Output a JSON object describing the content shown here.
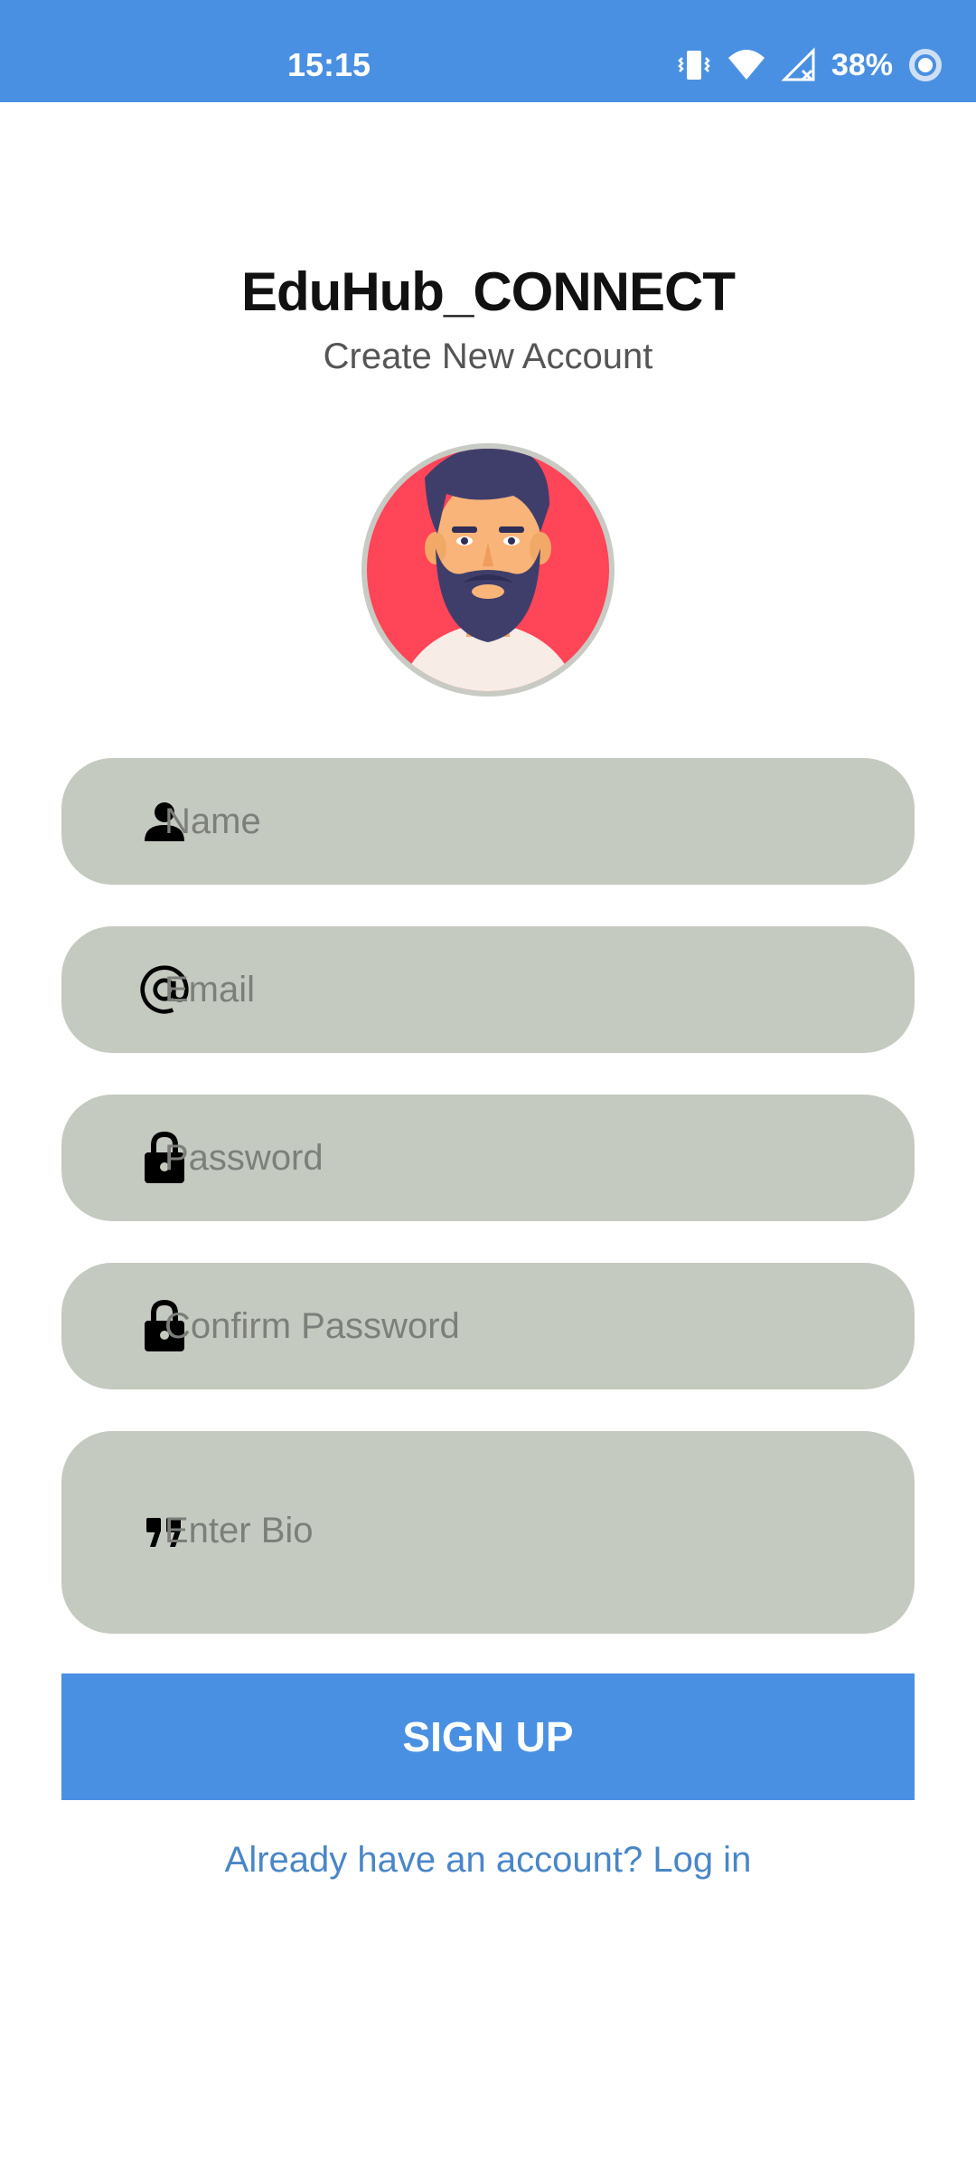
{
  "status_bar": {
    "time": "15:15",
    "battery_percent": "38%",
    "icons": [
      "vibrate-icon",
      "wifi-icon",
      "cell-signal-off-icon",
      "battery-ring-icon"
    ]
  },
  "app": {
    "title": "EduHub_CONNECT",
    "subtitle": "Create New Account"
  },
  "avatar": {
    "icon": "bearded-man-avatar"
  },
  "form": {
    "name": {
      "placeholder": "Name",
      "value": "",
      "icon": "person-icon"
    },
    "email": {
      "placeholder": "Email",
      "value": "",
      "icon": "at-sign-icon"
    },
    "password": {
      "placeholder": "Password",
      "value": "",
      "icon": "lock-icon"
    },
    "confirm_password": {
      "placeholder": "Confirm Password",
      "value": "",
      "icon": "lock-icon"
    },
    "bio": {
      "placeholder": "Enter Bio",
      "value": "",
      "icon": "quote-icon"
    }
  },
  "actions": {
    "signup_label": "SIGN UP",
    "login_link": "Already have an account? Log in"
  },
  "colors": {
    "primary": "#4a90e2",
    "field_bg": "#c5cac0",
    "link": "#4a86c8",
    "avatar_bg": "#ff4557"
  }
}
